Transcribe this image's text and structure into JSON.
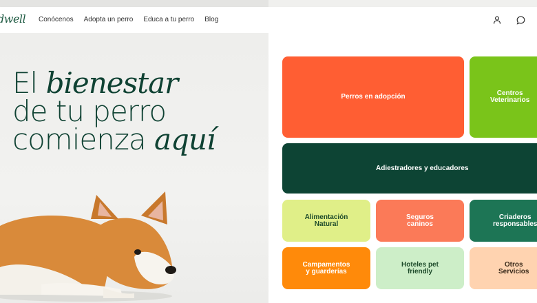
{
  "brand": {
    "logo": "dwell"
  },
  "nav": {
    "links": [
      "Conócenos",
      "Adopta un perro",
      "Educa a tu perro",
      "Blog"
    ],
    "icons": [
      "user-icon",
      "chat-bubble-icon"
    ]
  },
  "hero": {
    "line1_a": "El ",
    "line1_b": "bienestar",
    "line2": "de tu perro",
    "line3_a": "comienza ",
    "line3_b": "aquí"
  },
  "tiles": {
    "perros": "Perros en adopción",
    "centros": "Centros\nVeterinarios",
    "adiestradores": "Adiestradores y educadores",
    "alimentacion": "Alimentación\nNatural",
    "seguros": "Seguros\ncaninos",
    "criaderos": "Criaderos\nresponsables",
    "campamentos": "Campamentos\ny guarderías",
    "hoteles": "Hoteles pet\nfriendly",
    "otros": "Otros\nServicios"
  },
  "colors": {
    "orange_red": "#ff5e33",
    "lime": "#7ac41a",
    "dark_green": "#0d4434",
    "pale_lime": "#e0ef88",
    "salmon": "#fb7a58",
    "forest": "#1d7555",
    "orange": "#ff8a0a",
    "mint": "#cdeec8",
    "peach": "#ffd3b0"
  }
}
